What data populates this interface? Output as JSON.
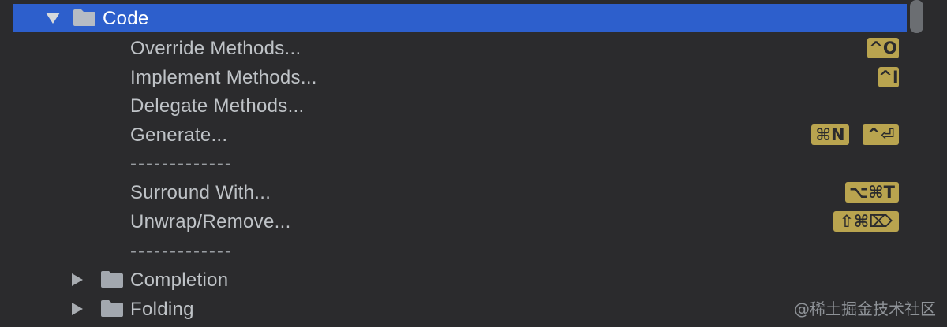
{
  "tree": {
    "group": {
      "label": "Code",
      "expanded": true,
      "selected": true
    },
    "actions": [
      {
        "label": "Override Methods...",
        "shortcuts": [
          "^O"
        ]
      },
      {
        "label": "Implement Methods...",
        "shortcuts": [
          "^I"
        ]
      },
      {
        "label": "Delegate Methods...",
        "shortcuts": []
      },
      {
        "label": "Generate...",
        "shortcuts": [
          "⌘N",
          "^⏎"
        ]
      },
      {
        "label": "-------------",
        "separator": true
      },
      {
        "label": "Surround With...",
        "shortcuts": [
          "⌥⌘T"
        ]
      },
      {
        "label": "Unwrap/Remove...",
        "shortcuts": [
          "⇧⌘⌦"
        ]
      },
      {
        "label": "-------------",
        "separator": true
      }
    ],
    "subgroups": [
      {
        "label": "Completion",
        "expanded": false
      },
      {
        "label": "Folding",
        "expanded": false
      }
    ]
  },
  "watermark": "@稀土掘金技术社区",
  "colors": {
    "background": "#2b2b2d",
    "selection": "#2d5fcc",
    "shortcut_badge": "#b9a44f",
    "text": "#bfc3c7"
  }
}
